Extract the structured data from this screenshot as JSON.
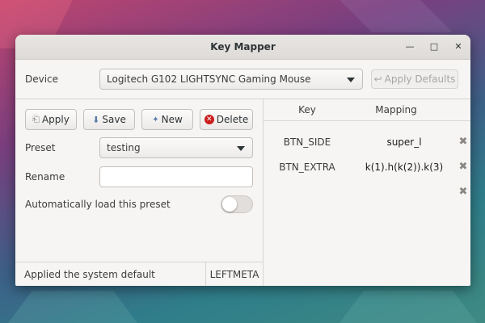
{
  "window": {
    "title": "Key Mapper",
    "controls": [
      "minimize",
      "maximize",
      "close"
    ]
  },
  "device": {
    "label": "Device",
    "selected": "Logitech G102 LIGHTSYNC Gaming Mouse",
    "apply_defaults_label": "Apply Defaults"
  },
  "toolbar": {
    "apply_label": "Apply",
    "save_label": "Save",
    "new_label": "New",
    "delete_label": "Delete"
  },
  "preset": {
    "label": "Preset",
    "selected": "testing"
  },
  "rename": {
    "label": "Rename",
    "value": ""
  },
  "autoload": {
    "label": "Automatically load this preset",
    "enabled": false
  },
  "status": {
    "message": "Applied the system default",
    "key": "LEFTMETA"
  },
  "mapping_table": {
    "headers": {
      "key": "Key",
      "mapping": "Mapping"
    },
    "rows": [
      {
        "key": "BTN_SIDE",
        "mapping": "super_l"
      },
      {
        "key": "BTN_EXTRA",
        "mapping": "k(1).h(k(2)).k(3)"
      },
      {
        "key": "",
        "mapping": ""
      }
    ]
  },
  "colors": {
    "delete_icon": "#cc1c1c",
    "window_bg": "#f6f5f4"
  }
}
